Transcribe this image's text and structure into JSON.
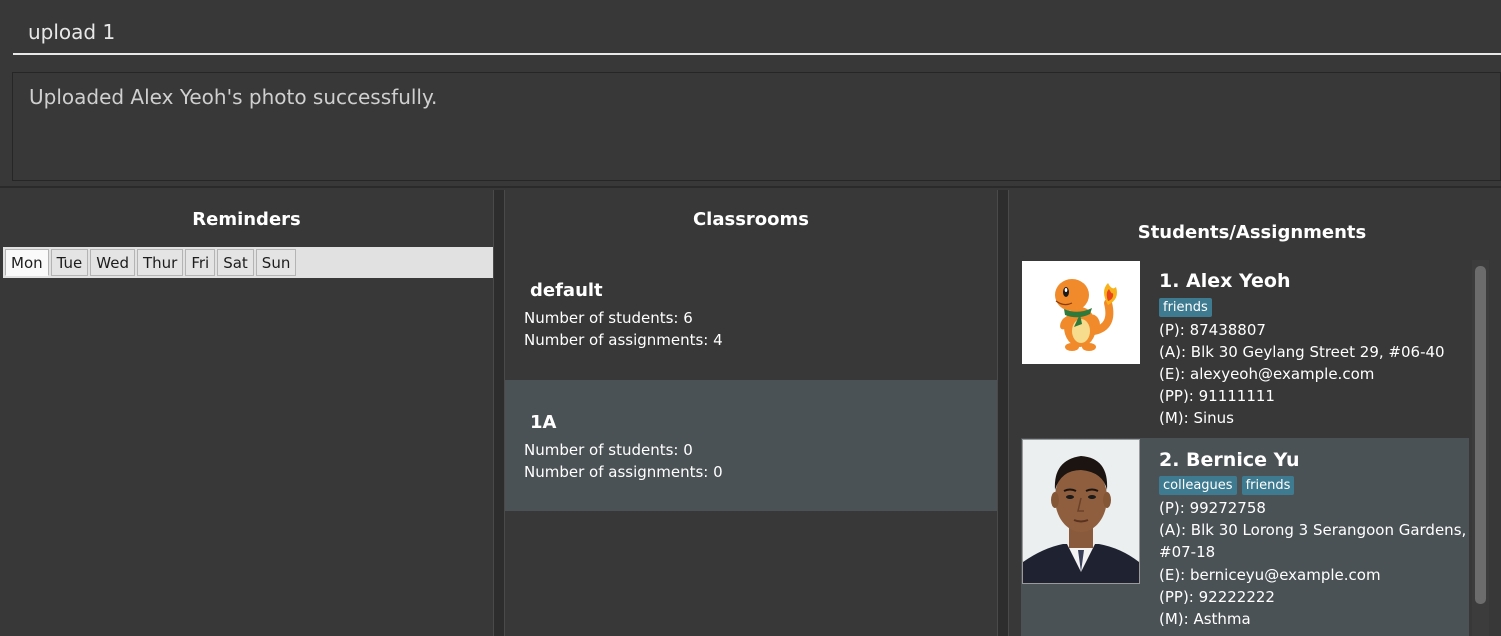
{
  "command": {
    "value": "upload 1"
  },
  "result": {
    "text": "Uploaded Alex Yeoh's photo successfully."
  },
  "reminders": {
    "title": "Reminders",
    "days": [
      "Mon",
      "Tue",
      "Wed",
      "Thur",
      "Fri",
      "Sat",
      "Sun"
    ],
    "selected_day": "Mon"
  },
  "classrooms": {
    "title": "Classrooms",
    "items": [
      {
        "name": "default",
        "students": "Number of students: 6",
        "assignments": "Number of assignments: 4",
        "selected": false
      },
      {
        "name": "1A",
        "students": "Number of students: 0",
        "assignments": "Number of assignments: 0",
        "selected": true
      }
    ]
  },
  "students": {
    "title": "Students/Assignments",
    "items": [
      {
        "name": "1.  Alex Yeoh",
        "tags": [
          "friends"
        ],
        "phone": "(P): 87438807",
        "address": "(A): Blk 30 Geylang Street 29, #06-40",
        "email": "(E): alexyeoh@example.com",
        "parent_phone": "(PP): 91111111",
        "medical": "(M): Sinus"
      },
      {
        "name": "2.  Bernice Yu",
        "tags": [
          "colleagues",
          "friends"
        ],
        "phone": "(P): 99272758",
        "address_line1": "(A): Blk 30 Lorong 3 Serangoon Gardens,",
        "address_line2": "#07-18",
        "email": "(E): berniceyu@example.com",
        "parent_phone": "(PP): 92222222",
        "medical": "(M): Asthma"
      }
    ]
  },
  "colors": {
    "background": "#383838",
    "selected_card": "#4b5256",
    "tag": "#3e7b91",
    "text": "#ffffff"
  }
}
